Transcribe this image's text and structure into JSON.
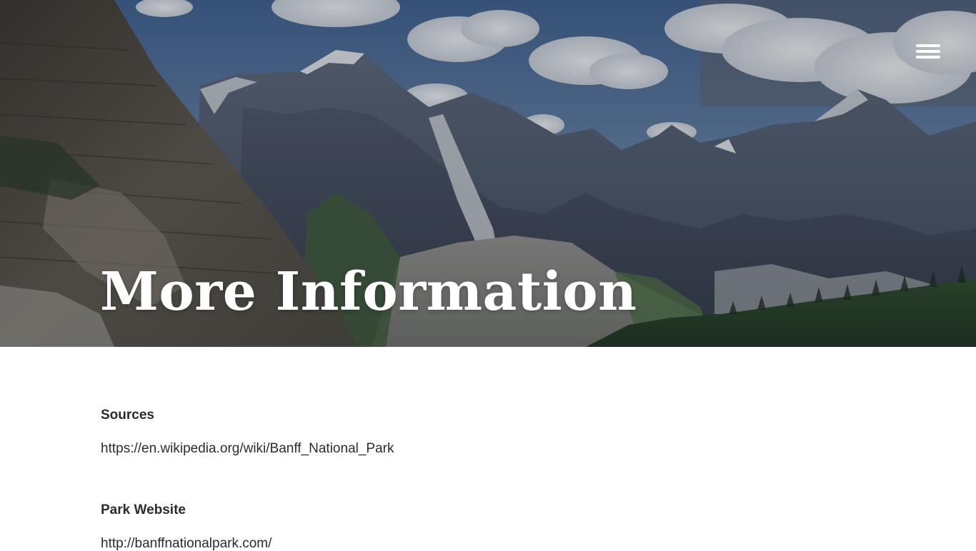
{
  "hero": {
    "title": "More Information"
  },
  "nav": {
    "menu_icon": "hamburger-menu-icon"
  },
  "sections": [
    {
      "heading": "Sources",
      "link": "https://en.wikipedia.org/wiki/Banff_National_Park"
    },
    {
      "heading": "Park Website",
      "link": "http://banffnationalpark.com/"
    }
  ],
  "colors": {
    "text": "#2a2c30",
    "title": "#ffffff",
    "background": "#ffffff"
  }
}
